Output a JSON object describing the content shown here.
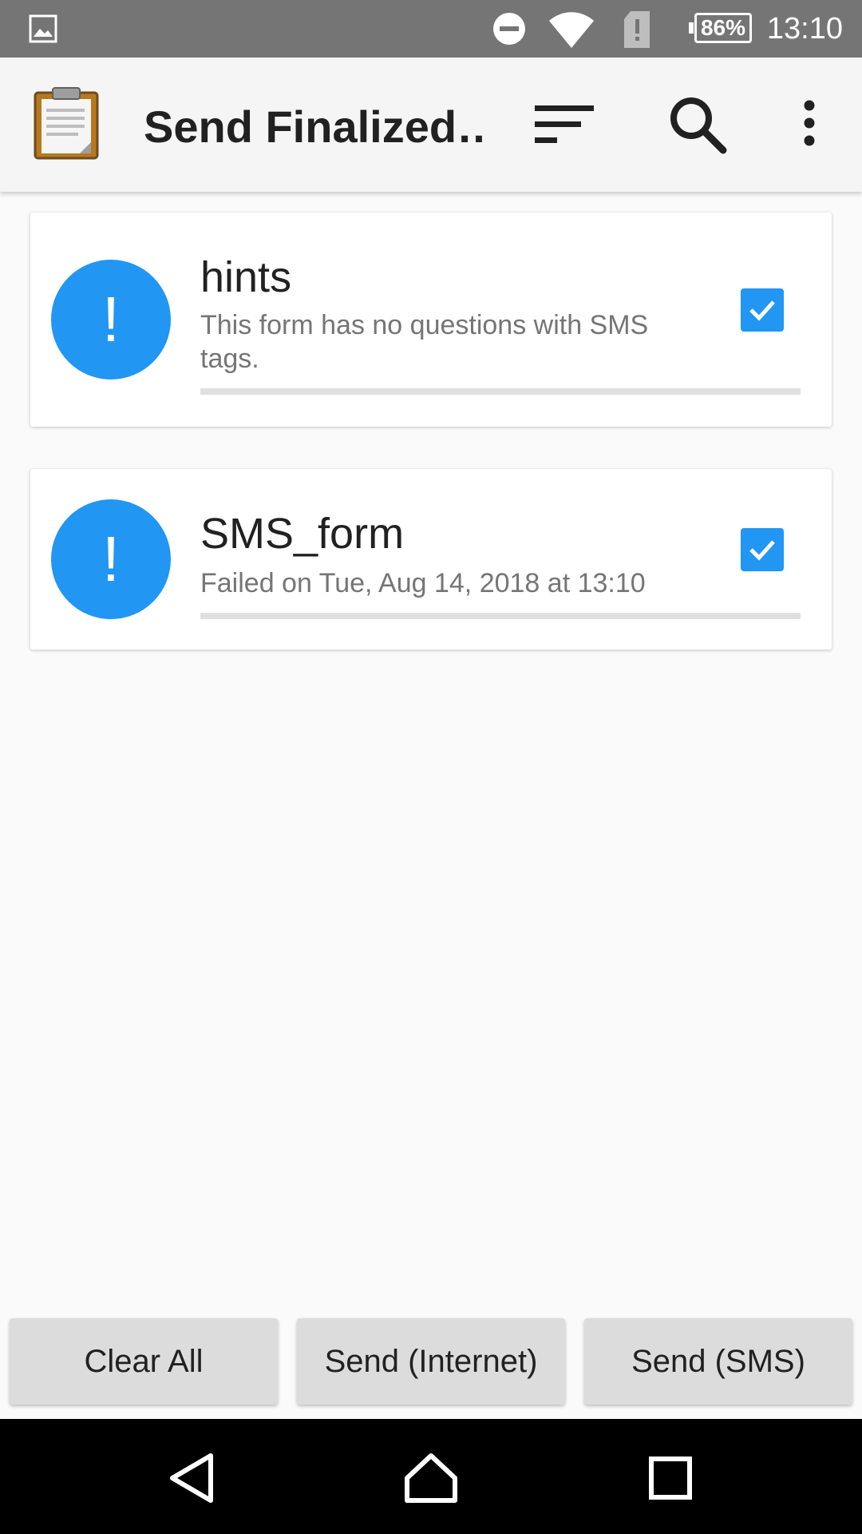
{
  "status_bar": {
    "time": "13:10",
    "battery": "86%",
    "icons": [
      "image-icon",
      "do-not-disturb-icon",
      "wifi-icon",
      "sim-alert-icon",
      "battery-icon"
    ]
  },
  "app_bar": {
    "title": "Send Finalized…",
    "icons": [
      "clipboard-icon",
      "sort-icon",
      "search-icon",
      "more-vert-icon"
    ]
  },
  "forms": [
    {
      "title": "hints",
      "subtitle": "This form has no questions with SMS tags.",
      "status_icon": "!",
      "checked": true
    },
    {
      "title": "SMS_form",
      "subtitle": "Failed on Tue, Aug 14, 2018 at 13:10",
      "status_icon": "!",
      "checked": true
    }
  ],
  "buttons": {
    "clear_all": "Clear All",
    "send_internet": "Send (Internet)",
    "send_sms": "Send (SMS)"
  },
  "nav_bar": {
    "icons": [
      "back-icon",
      "home-icon",
      "recents-icon"
    ]
  },
  "colors": {
    "accent": "#2196f3",
    "status_bar": "#757575",
    "app_bar": "#f5f5f5",
    "button": "#dcdcdc"
  }
}
